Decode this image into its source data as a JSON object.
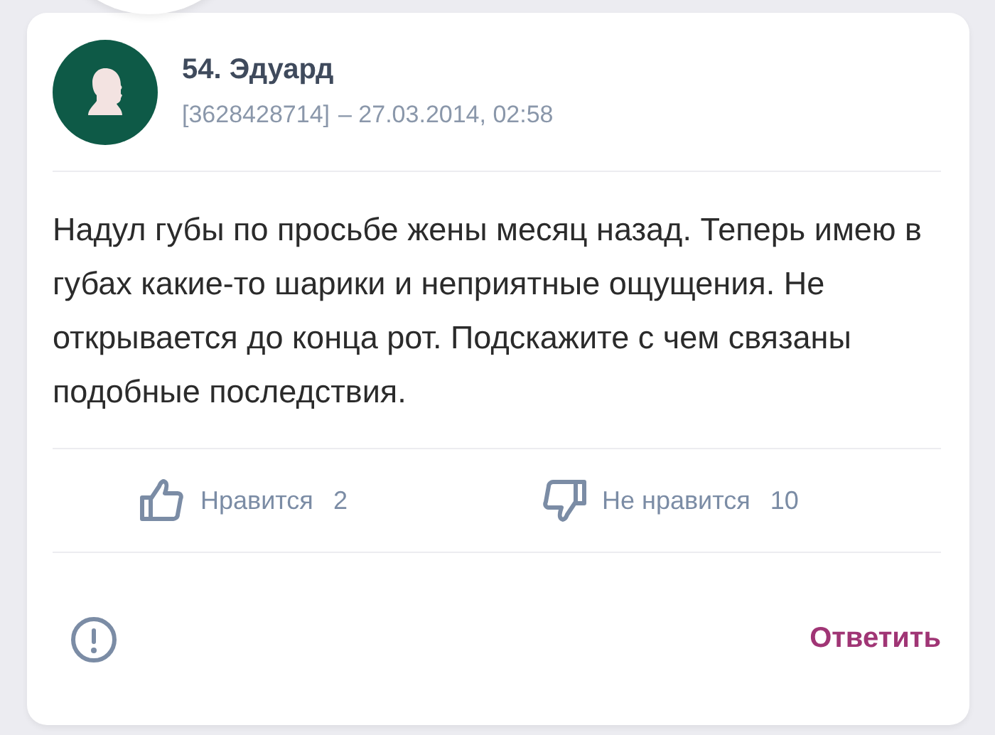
{
  "comment": {
    "author": "54. Эдуард",
    "id": "[3628428714]",
    "date": "– 27.03.2014, 02:58",
    "text": "Надул губы по просьбе жены месяц назад. Теперь имею в губах какие-то шарики и неприятные ощущения. Не открывается до конца рот. Подскажите с чем связаны подобные последствия."
  },
  "reactions": [
    {
      "kind": "like",
      "label": "Нравится",
      "count": "2"
    },
    {
      "kind": "dislike",
      "label": "Не нравится",
      "count": "10"
    }
  ],
  "reply_button": "Ответить"
}
